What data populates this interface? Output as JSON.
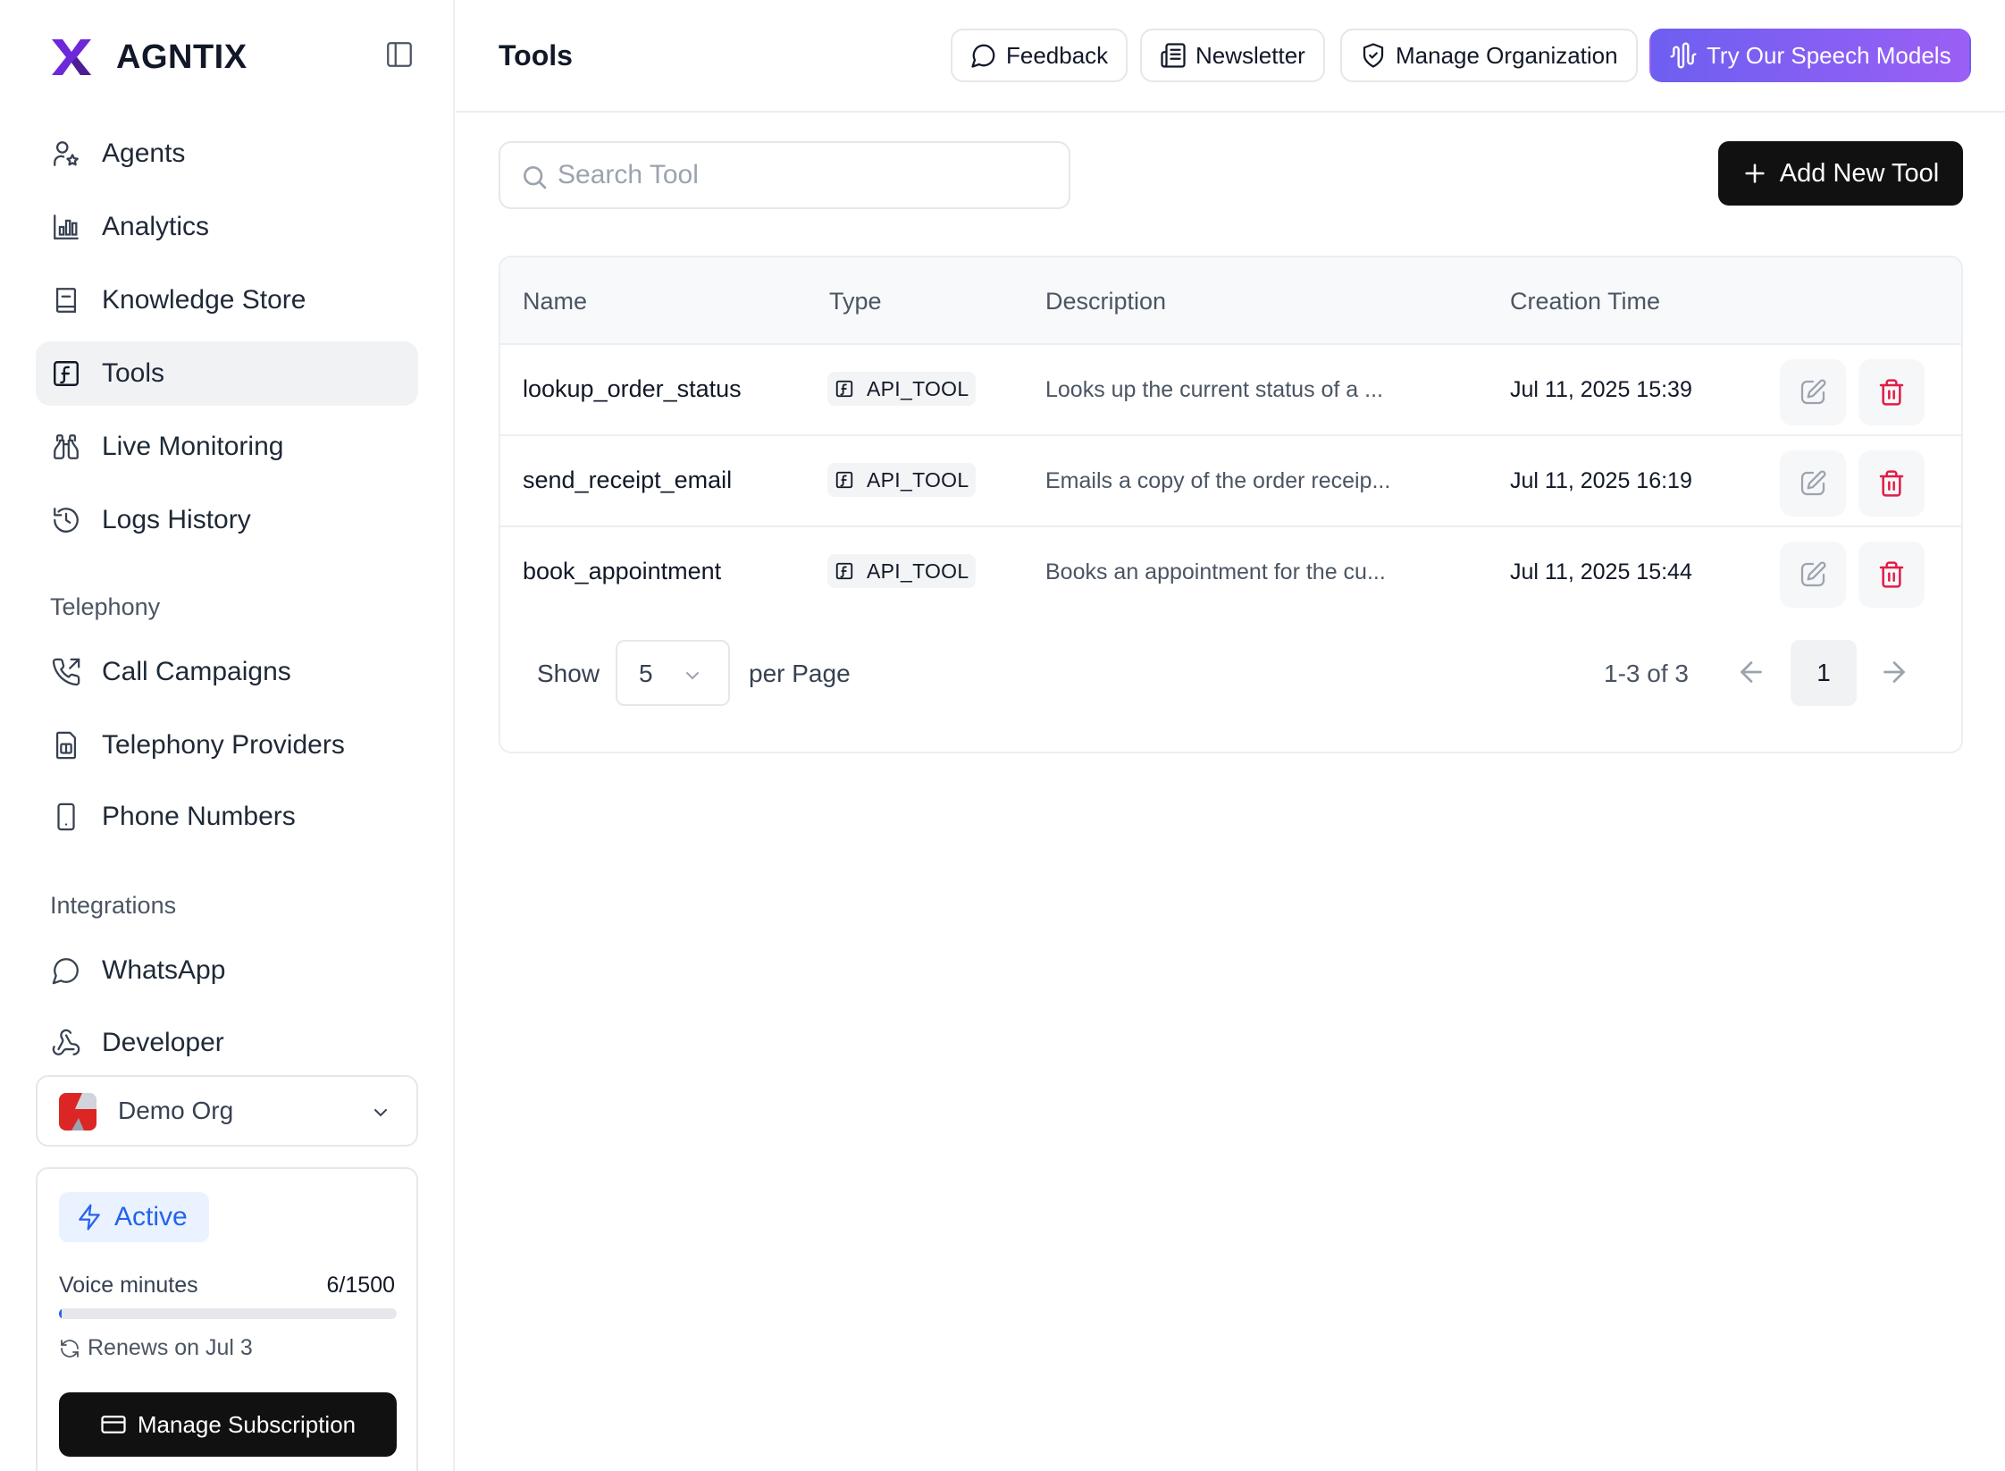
{
  "brand": {
    "name": "AGNTIX",
    "logo_color": "#6d28d9"
  },
  "sidebar": {
    "items": [
      {
        "label": "Agents",
        "icon": "user-star-icon"
      },
      {
        "label": "Analytics",
        "icon": "bar-chart-icon"
      },
      {
        "label": "Knowledge Store",
        "icon": "book-icon"
      },
      {
        "label": "Tools",
        "icon": "function-square-icon",
        "active": true
      },
      {
        "label": "Live Monitoring",
        "icon": "binoculars-icon"
      },
      {
        "label": "Logs History",
        "icon": "history-icon"
      }
    ],
    "telephony_title": "Telephony",
    "telephony": [
      {
        "label": "Call Campaigns",
        "icon": "phone-outgoing-icon"
      },
      {
        "label": "Telephony Providers",
        "icon": "sim-card-icon"
      },
      {
        "label": "Phone Numbers",
        "icon": "smartphone-icon"
      }
    ],
    "integrations_title": "Integrations",
    "integrations": [
      {
        "label": "WhatsApp",
        "icon": "message-circle-icon"
      },
      {
        "label": "Developer",
        "icon": "webhook-icon"
      }
    ],
    "org": {
      "name": "Demo Org"
    },
    "plan": {
      "status": "Active",
      "usage_label": "Voice minutes",
      "usage_value": "6/1500",
      "usage_fraction": 0.004,
      "renew_text": "Renews on Jul 3",
      "manage_label": "Manage Subscription"
    }
  },
  "header": {
    "title": "Tools",
    "feedback": "Feedback",
    "newsletter": "Newsletter",
    "manage_org": "Manage Organization",
    "speech": "Try Our Speech Models"
  },
  "toolbar": {
    "search_placeholder": "Search Tool",
    "add_label": "Add New Tool"
  },
  "table": {
    "columns": [
      "Name",
      "Type",
      "Description",
      "Creation Time"
    ],
    "rows": [
      {
        "name": "lookup_order_status",
        "type": "API_TOOL",
        "description": "Looks up the current status of a ...",
        "created": "Jul 11, 2025 15:39"
      },
      {
        "name": "send_receipt_email",
        "type": "API_TOOL",
        "description": "Emails a copy of the order receip...",
        "created": "Jul 11, 2025 16:19"
      },
      {
        "name": "book_appointment",
        "type": "API_TOOL",
        "description": "Books an appointment for the cu...",
        "created": "Jul 11, 2025 15:44"
      }
    ]
  },
  "pagination": {
    "show_label": "Show",
    "per_page": "5",
    "per_page_label": "per Page",
    "range": "1-3 of 3",
    "current_page": "1"
  },
  "colors": {
    "accent_blue": "#2563eb",
    "danger": "#e11d48",
    "speech_gradient_start": "#6d5ff0",
    "speech_gradient_end": "#9b5ff5"
  }
}
